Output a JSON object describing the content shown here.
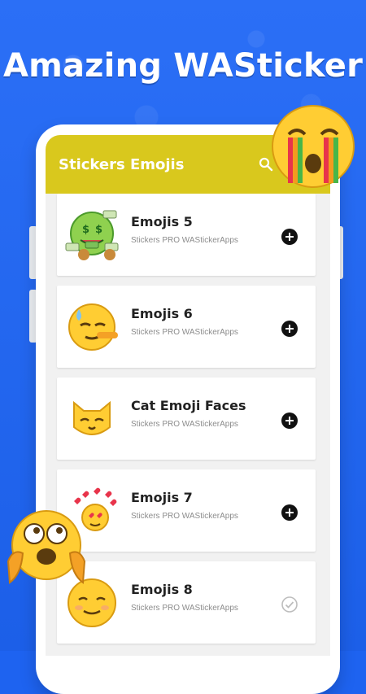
{
  "headline": "Amazing WASticker",
  "appbar": {
    "title": "Stickers Emojis",
    "search_icon": "search-icon"
  },
  "packs": [
    {
      "title": "Emojis 5",
      "publisher": "Stickers PRO WAStickerApps",
      "action": "add",
      "thumb": "money-face"
    },
    {
      "title": "Emojis 6",
      "publisher": "Stickers PRO WAStickerApps",
      "action": "add",
      "thumb": "lying-sweat-face"
    },
    {
      "title": "Cat Emoji Faces",
      "publisher": "Stickers PRO WAStickerApps",
      "action": "add",
      "thumb": "cat-face"
    },
    {
      "title": "Emojis 7",
      "publisher": "Stickers PRO WAStickerApps",
      "action": "add",
      "thumb": "heart-eyes-face"
    },
    {
      "title": "Emojis 8",
      "publisher": "Stickers PRO WAStickerApps",
      "action": "added",
      "thumb": "smiling-face"
    }
  ],
  "colors": {
    "background": "#1e63f0",
    "appbar": "#d9c81d",
    "card": "#ffffff",
    "accent_text": "#222222"
  }
}
